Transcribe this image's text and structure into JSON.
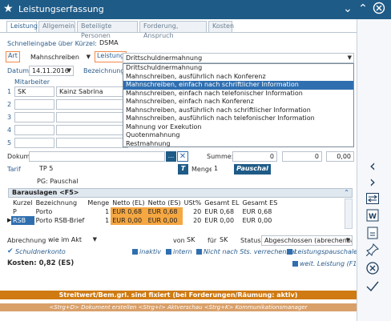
{
  "window": {
    "title": "Leistungserfassung"
  },
  "tabs": [
    {
      "label": "Leistung"
    },
    {
      "label": "Allgemein"
    },
    {
      "label": "Beteiligte Personen"
    },
    {
      "label": "Forderung, Anspruch"
    },
    {
      "label": "Kosten"
    }
  ],
  "schnelleingabe": {
    "label": "Schnelleingabe über Kürzel:",
    "value": "DSMA"
  },
  "art": {
    "label": "Art",
    "value": "Mahnschreiben"
  },
  "leistung": {
    "label": "Leistung",
    "value": "Drittschuldnermahnung"
  },
  "datum": {
    "label": "Datum",
    "value": "14.11.2016"
  },
  "bezeichnung": {
    "label": "Bezeichnung"
  },
  "mitarbeiter": {
    "label": "Mitarbeiter",
    "rows": [
      {
        "num": "1",
        "kurz": "SK",
        "name": "Kainz Sabrina"
      },
      {
        "num": "2",
        "kurz": "",
        "name": ""
      },
      {
        "num": "3",
        "kurz": "",
        "name": ""
      },
      {
        "num": "4",
        "kurz": "",
        "name": ""
      },
      {
        "num": "5",
        "kurz": "",
        "name": ""
      }
    ]
  },
  "dropdown": {
    "items": [
      "Drittschuldnermahnung",
      "Mahnschreiben, ausführlich nach Konferenz",
      "Mahnschreiben, einfach nach schriftlicher Information",
      "Mahnschreiben, einfach nach telefonischer Information",
      "Mahnschreiben, einfach nach Konferenz",
      "Mahnschreiben, ausführlich nach schriftlicher Information",
      "Mahnschreiben, ausführlich nach telefonischer Information",
      "Mahnung vor Exekution",
      "Quotenmahnung",
      "Restmahnung"
    ],
    "selected_index": 2
  },
  "dokument": {
    "label": "Dokument",
    "btn": "...",
    "close": "✕"
  },
  "summe": {
    "label": "Summe:",
    "v1": "0",
    "v2": "0",
    "v3": "0,00"
  },
  "tarif": {
    "label": "Tarif",
    "value": "TP 5",
    "t": "T",
    "menge_label": "Menge",
    "menge": "1",
    "pauschal": "Pauschal"
  },
  "pg": "PG: Pauschal",
  "barauslagen": {
    "title": "Barauslagen <F5>",
    "headers": [
      "Kurzel",
      "Bezeichnung",
      "Menge",
      "Netto (EL)",
      "Netto (ES)",
      "USt%",
      "Gesamt EL",
      "Gesamt ES"
    ],
    "rows": [
      [
        "P",
        "Porto",
        "1",
        "EUR 0,68",
        "EUR 0,68",
        "20",
        "EUR 0,68",
        "EUR 0,68"
      ],
      [
        "RSB",
        "Porto RSB-Brief",
        "1",
        "EUR 0,00",
        "EUR 0,00",
        "20",
        "EUR 0,00",
        "EUR 0,00"
      ]
    ]
  },
  "abrechnung": {
    "label": "Abrechnung",
    "value": "wie im Akt",
    "von_label": "von",
    "von": "SK",
    "fuer_label": "für",
    "fuer": "SK",
    "status_label": "Status",
    "status": "Abgeschlossen (abrechenbar)"
  },
  "checks": {
    "schuldnerkonto": "Schuldnerkonto",
    "inaktiv": "inaktiv",
    "intern": "intern",
    "nicht_vr": "Nicht nach Sts. verrechenbar",
    "pauschale": "Leistungspauschale",
    "weit": "weit. Leistung (F10)"
  },
  "kosten": "Kosten: 0,82 (ES)",
  "statusbar": "Streitwert/Bem.grl. sind fixiert (bei Forderungen/Räumung: aktiv)",
  "hintbar": "<Strg+D> Dokument erstellen <Strg+I> Aktverschau <Strg+K> Kommunikationsmanager",
  "sidebar": [
    "chevron-left-icon",
    "chevron-right-icon",
    "swap-icon",
    "word-icon",
    "document-icon",
    "pin-icon",
    "cancel-icon",
    "confirm-icon"
  ]
}
